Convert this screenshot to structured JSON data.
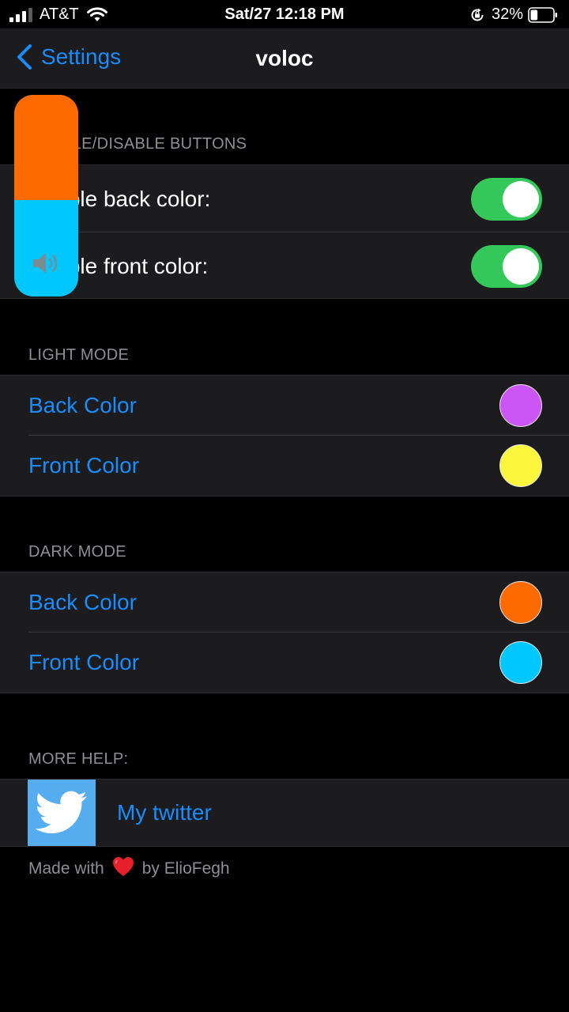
{
  "status_bar": {
    "carrier": "AT&T",
    "time": "Sat/27 12:18 PM",
    "battery_percent": "32%",
    "battery_level": 0.32,
    "icons": [
      "signal-bars-icon",
      "wifi-icon",
      "orientation-lock-icon",
      "battery-icon"
    ]
  },
  "nav": {
    "back_label": "Settings",
    "title": "voloc"
  },
  "sections": {
    "enable": {
      "header": "ENABLE/DISABLE BUTTONS",
      "rows": [
        {
          "label": "Enable back color:",
          "on": true
        },
        {
          "label": "Enable front color:",
          "on": true
        }
      ]
    },
    "light": {
      "header": "LIGHT MODE",
      "rows": [
        {
          "label": "Back Color",
          "color": "#cc55f5"
        },
        {
          "label": "Front Color",
          "color": "#fcf63c"
        }
      ]
    },
    "dark": {
      "header": "DARK MODE",
      "rows": [
        {
          "label": "Back Color",
          "color": "#ff6a00"
        },
        {
          "label": "Front Color",
          "color": "#00c8ff"
        }
      ]
    },
    "help": {
      "header": "MORE HELP:",
      "twitter_label": "My twitter",
      "twitter_icon": "twitter-bird-icon"
    }
  },
  "footer": {
    "prefix": "Made with",
    "heart_icon": "heart-icon",
    "suffix": "by ElioFegh"
  },
  "volume_hud": {
    "level": 0.52,
    "fill_color": "#ff6a00",
    "track_color": "#00c8ff",
    "icon": "speaker-icon"
  },
  "colors": {
    "accent": "#1a8cff",
    "switch_on": "#34c759",
    "cell_bg": "#1c1c1e"
  }
}
